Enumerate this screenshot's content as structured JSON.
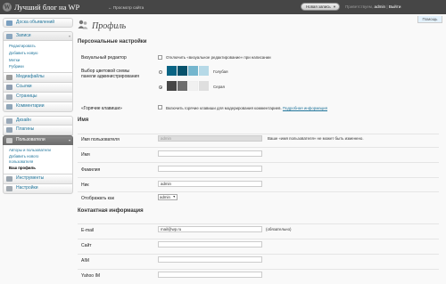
{
  "header": {
    "site_title": "Лучший блог на WP",
    "visit_site": "← Просмотр сайта",
    "new_post": "Новая запись",
    "greeting": "Приветствуем,",
    "username": "admin",
    "separator": "|",
    "logout": "Выйти"
  },
  "help": "Помощь",
  "sidebar": {
    "dashboard": "Доска объявлений",
    "posts": "Записи",
    "posts_sub": [
      "Редактировать",
      "Добавить новую",
      "Метки",
      "Рубрики"
    ],
    "media": "Медиафайлы",
    "links": "Ссылки",
    "pages": "Страницы",
    "comments": "Комментарии",
    "appearance": "Дизайн",
    "plugins": "Плагины",
    "users": "Пользователи",
    "users_sub": [
      "Авторы и пользователи",
      "Добавить нового",
      "пользователя",
      "Ваш профиль"
    ],
    "tools": "Инструменты",
    "settings": "Настройки"
  },
  "page": {
    "title": "Профиль",
    "personal_section": "Персональные настройки",
    "visual_editor_label": "Визуальный редактор",
    "visual_editor_hint": "Отключить «визуальное редактирование» при написании",
    "color_scheme_label_1": "Выбор цветовой схемы",
    "color_scheme_label_2": "панели администрирования",
    "scheme_blue": "Голубая",
    "scheme_gray": "Серая",
    "hotkeys_label": "«Горячие клавиши»",
    "hotkeys_hint": "Включить горячие клавиши для модерирования комментариев.",
    "hotkeys_link": "Подробная информация",
    "name_section": "Имя",
    "username_label": "Имя пользователя",
    "username_value": "admin",
    "username_hint": "Ваше «имя пользователя» не может быть изменено.",
    "first_name_label": "Имя",
    "last_name_label": "Фамилия",
    "nickname_label": "Ник",
    "nickname_value": "admin",
    "display_as_label": "Отображать как",
    "display_as_value": "admin",
    "contact_section": "Контактная информация",
    "email_label": "E-mail",
    "email_value": "mail@wp.ru",
    "email_hint": "(обязательно)",
    "site_label": "Сайт",
    "aim_label": "AIM",
    "yahoo_label": "Yahoo IM"
  },
  "colors": {
    "header_bg": "#464646",
    "link": "#21759b",
    "blue_scheme": [
      "#096484",
      "#07526c",
      "#74b6ce",
      "#b6d9e7"
    ],
    "gray_scheme": [
      "#464646",
      "#6d6d6d",
      "#f1f1f1",
      "#dfdfdf"
    ]
  }
}
